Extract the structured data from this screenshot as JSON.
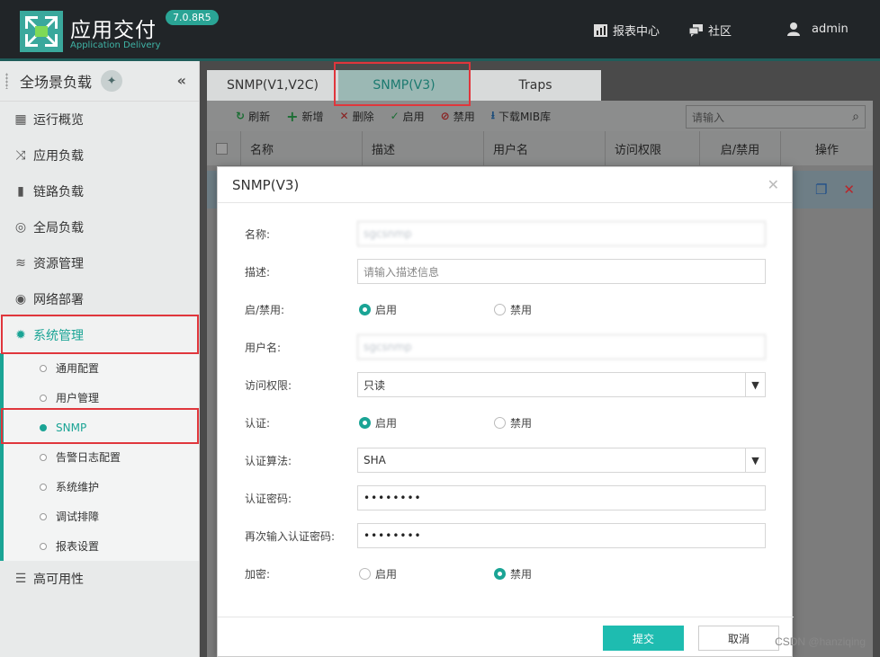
{
  "header": {
    "title": "应用交付",
    "subtitle": "Application Delivery",
    "version": "7.0.8R5",
    "reports_label": "报表中心",
    "community_label": "社区",
    "user_label": "admin"
  },
  "sidebar": {
    "title": "全场景负载",
    "collapse_glyph": "«",
    "items": [
      {
        "label": "运行概览",
        "icon": "dashboard-icon"
      },
      {
        "label": "应用负载",
        "icon": "shuffle-icon"
      },
      {
        "label": "链路负载",
        "icon": "link-icon"
      },
      {
        "label": "全局负载",
        "icon": "globe-icon"
      },
      {
        "label": "资源管理",
        "icon": "layers-icon"
      },
      {
        "label": "网络部署",
        "icon": "network-icon"
      },
      {
        "label": "系统管理",
        "icon": "gear-icon"
      },
      {
        "label": "高可用性",
        "icon": "list-icon"
      }
    ],
    "sub_items": [
      {
        "label": "通用配置"
      },
      {
        "label": "用户管理"
      },
      {
        "label": "SNMP"
      },
      {
        "label": "告警日志配置"
      },
      {
        "label": "系统维护"
      },
      {
        "label": "调试排障"
      },
      {
        "label": "报表设置"
      }
    ]
  },
  "tabs": [
    {
      "label": "SNMP(V1,V2C)"
    },
    {
      "label": "SNMP(V3)"
    },
    {
      "label": "Traps"
    }
  ],
  "toolbar": {
    "refresh": "刷新",
    "add": "新增",
    "delete": "删除",
    "enable": "启用",
    "disable": "禁用",
    "download_mib": "下载MIB库",
    "search_placeholder": "请输入"
  },
  "table": {
    "columns": [
      "名称",
      "描述",
      "用户名",
      "访问权限",
      "启/禁用",
      "操作"
    ]
  },
  "modal": {
    "title": "SNMP(V3)",
    "name_label": "名称:",
    "name_value": "sgcsnmp",
    "desc_label": "描述:",
    "desc_placeholder": "请输入描述信息",
    "enable_label": "启/禁用:",
    "radio_on": "启用",
    "radio_off": "禁用",
    "username_label": "用户名:",
    "username_value": "sgcsnmp",
    "access_label": "访问权限:",
    "access_value": "只读",
    "auth_label": "认证:",
    "algo_label": "认证算法:",
    "algo_value": "SHA",
    "authpw_label": "认证密码:",
    "authpw_value": "••••••••",
    "reauthpw_label": "再次输入认证密码:",
    "reauthpw_value": "••••••••",
    "encrypt_label": "加密:",
    "submit": "提交",
    "cancel": "取消"
  },
  "watermark": "CSDN @hanziqing",
  "colors": {
    "accent": "#1aa495",
    "highlight": "#e0363c"
  }
}
